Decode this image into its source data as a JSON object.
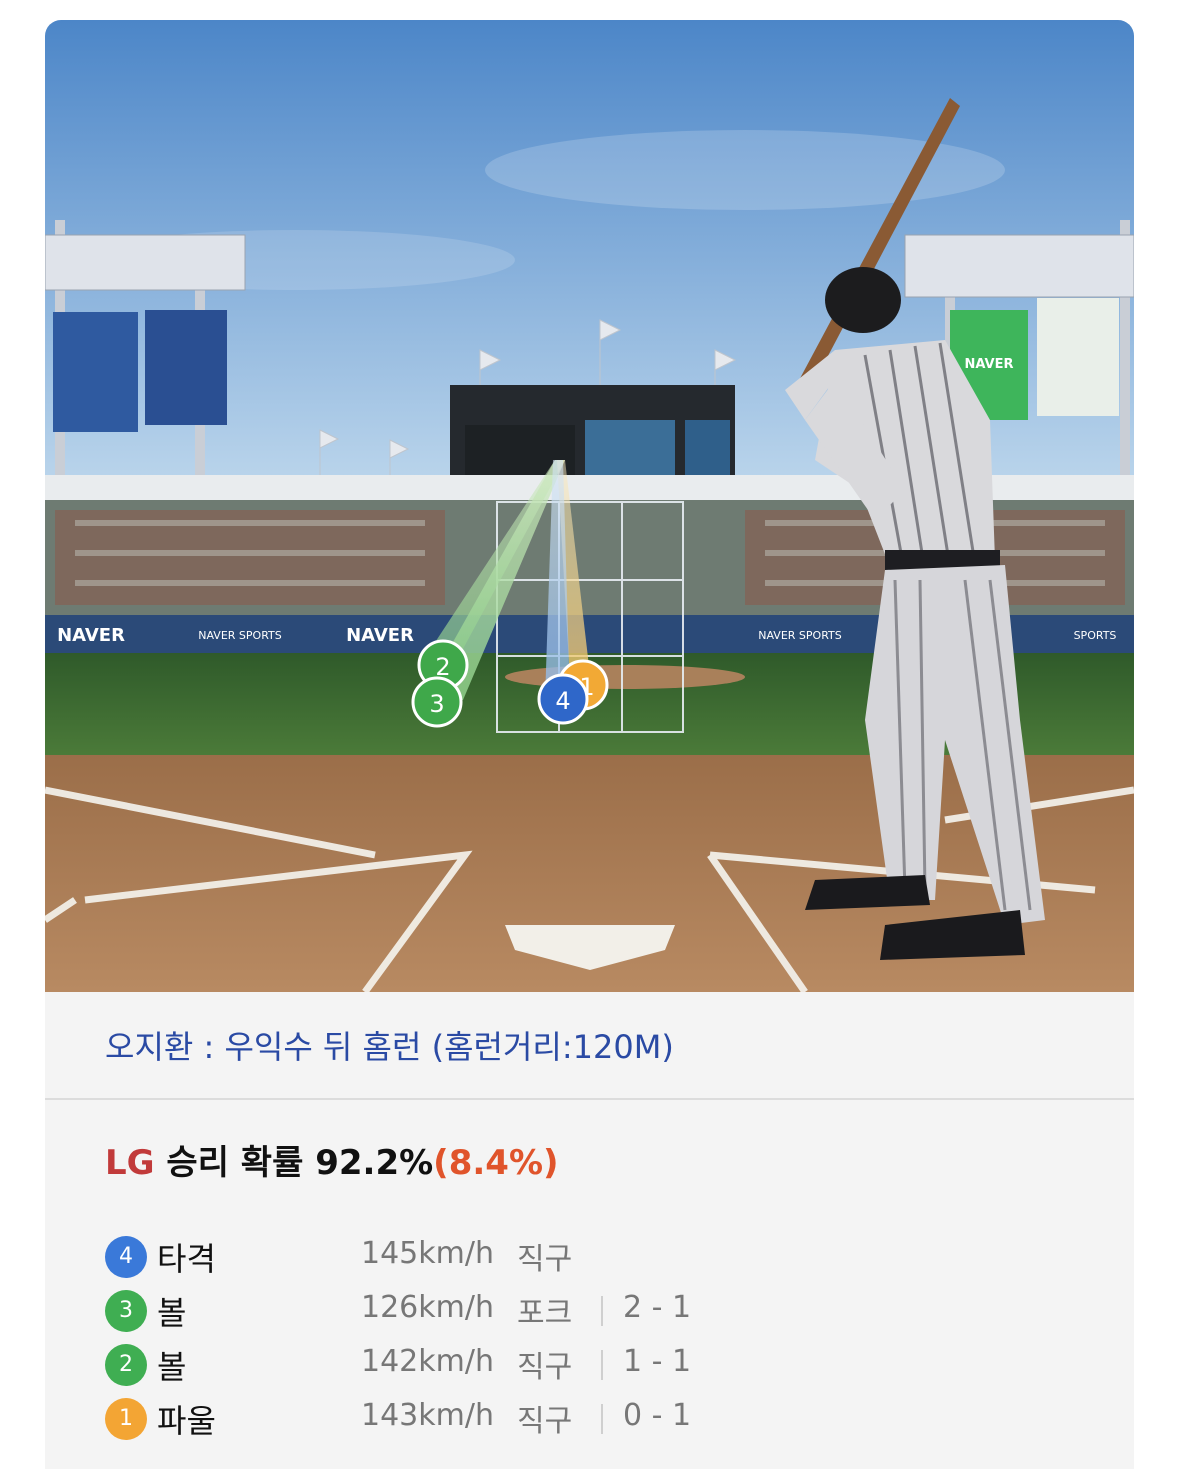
{
  "scene": {
    "ads": {
      "naver": "NAVER",
      "sports": "SPORTS",
      "naver_sports": "NAVER SPORTS"
    },
    "markers": [
      {
        "number": "2",
        "color": "#3fa84a"
      },
      {
        "number": "3",
        "color": "#3fa84a"
      },
      {
        "number": "1",
        "color": "#f2a935"
      },
      {
        "number": "4",
        "color": "#2f67c9"
      }
    ],
    "colors": {
      "sky_top": "#4c86c8",
      "sky_bottom": "#b7d2ea",
      "grass": "#3f6f33",
      "dirt": "#a77a55",
      "wall": "#2b4a78"
    }
  },
  "caption": "오지환 : 우익수 뒤 홈런 (홈런거리:120M)",
  "win_prob": {
    "team": "LG",
    "text": " 승리 확률 92.2%",
    "delta": "(8.4%)"
  },
  "pitches": [
    {
      "num": "4",
      "color": "#3a79d9",
      "result": "타격",
      "speed": "145km/h",
      "type": "직구",
      "count": ""
    },
    {
      "num": "3",
      "color": "#3fae52",
      "result": "볼",
      "speed": "126km/h",
      "type": "포크",
      "count": "2 - 1"
    },
    {
      "num": "2",
      "color": "#3fae52",
      "result": "볼",
      "speed": "142km/h",
      "type": "직구",
      "count": "1 - 1"
    },
    {
      "num": "1",
      "color": "#f3a534",
      "result": "파울",
      "speed": "143km/h",
      "type": "직구",
      "count": "0 - 1"
    }
  ]
}
